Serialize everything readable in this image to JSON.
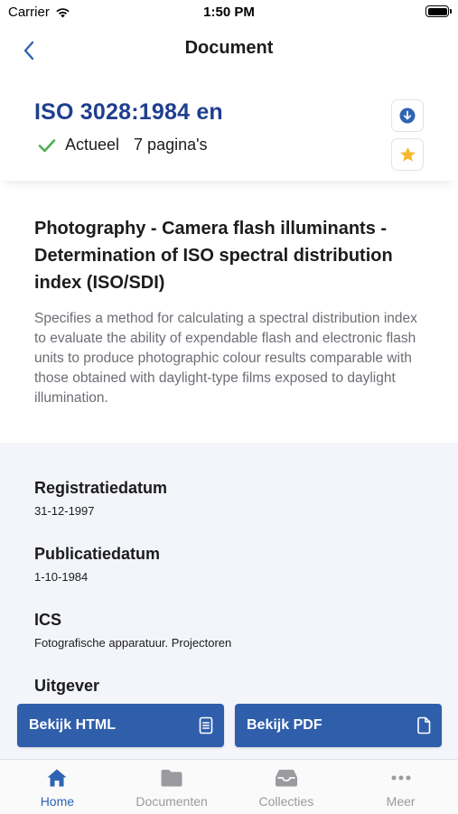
{
  "status_bar": {
    "carrier": "Carrier",
    "time": "1:50 PM"
  },
  "nav": {
    "title": "Document"
  },
  "document": {
    "id": "ISO 3028:1984 en",
    "status": "Actueel",
    "pages": "7 pagina's",
    "title": "Photography - Camera flash illuminants - Determination of ISO spectral distribution index (ISO/SDI)",
    "description": "Specifies a method for calculating a spectral distribution index to evaluate the ability of expendable flash and electronic flash units to produce photographic colour results comparable with those obtained with daylight-type films exposed to daylight illumination."
  },
  "details": {
    "registration": {
      "label": "Registratiedatum",
      "value": "31-12-1997"
    },
    "publication": {
      "label": "Publicatiedatum",
      "value": "1-10-1984"
    },
    "ics": {
      "label": "ICS",
      "value": "Fotografische apparatuur. Projectoren"
    },
    "publisher": {
      "label": "Uitgever"
    }
  },
  "actions": {
    "view_html": "Bekijk HTML",
    "view_pdf": "Bekijk PDF"
  },
  "tabs": [
    {
      "label": "Home",
      "icon": "home-icon"
    },
    {
      "label": "Documenten",
      "icon": "folder-icon"
    },
    {
      "label": "Collecties",
      "icon": "inbox-icon"
    },
    {
      "label": "Meer",
      "icon": "more-icon"
    }
  ],
  "colors": {
    "brand_blue": "#2f5eab",
    "id_blue": "#1f3f8f",
    "check_green": "#4caf50",
    "star_yellow": "#f5b82e",
    "tab_active": "#2f63b3",
    "tab_inactive": "#9a9a9f",
    "details_bg": "#f3f5fa"
  }
}
